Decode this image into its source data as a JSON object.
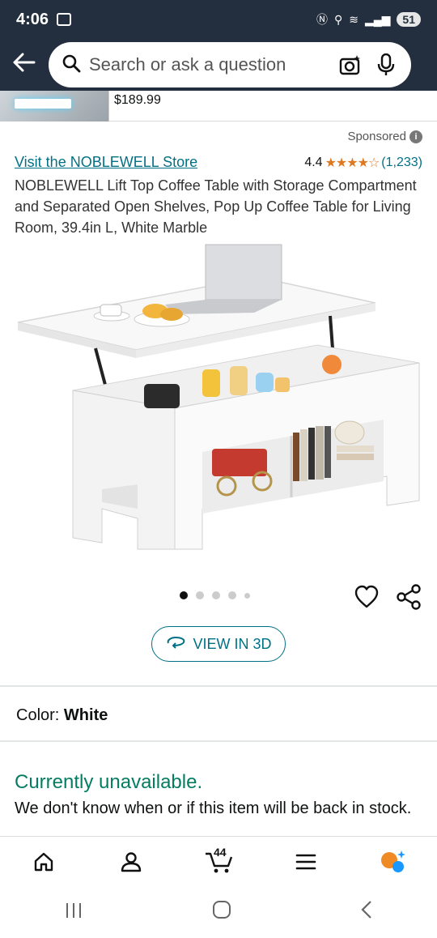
{
  "status_bar": {
    "time": "4:06",
    "battery": "51"
  },
  "search": {
    "placeholder": "Search or ask a question"
  },
  "previous_item": {
    "price": "$189.99"
  },
  "ad": {
    "sponsored_label": "Sponsored"
  },
  "product": {
    "store_link": "Visit the NOBLEWELL Store",
    "rating_value": "4.4",
    "rating_stars": "★★★★☆",
    "rating_count": "(1,233)",
    "title": "NOBLEWELL Lift Top Coffee Table with Storage Compartment and Separated Open Shelves, Pop Up Coffee Table for Living Room, 39.4in L, White Marble",
    "image_count": 5,
    "active_image_index": 0
  },
  "view3d": {
    "label": "VIEW IN 3D"
  },
  "color": {
    "label": "Color:",
    "value": "White"
  },
  "availability": {
    "status": "Currently unavailable.",
    "message": "We don't know when or if this item will be back in stock."
  },
  "bottom_nav": {
    "cart_count": "44"
  },
  "colors": {
    "header_bg": "#232f3e",
    "link": "#007185",
    "star": "#de7921",
    "available_green": "#067d62"
  }
}
